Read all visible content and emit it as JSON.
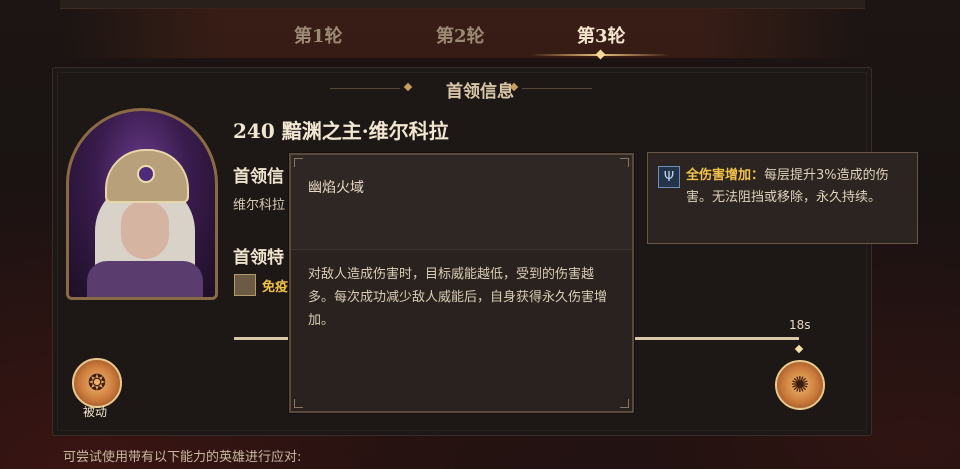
{
  "tabs": [
    {
      "label": "第1轮",
      "active": false
    },
    {
      "label": "第2轮",
      "active": false
    },
    {
      "label": "第3轮",
      "active": true
    }
  ],
  "panel": {
    "title": "首领信息",
    "boss_name": "240 黯渊之主·维尔科拉",
    "info_heading": "首领信",
    "info_text": "维尔科拉",
    "trait_heading": "首领特",
    "trait_label": "免疫",
    "timeline_label": "18s",
    "passive_label": "被动"
  },
  "skill_tooltip": {
    "title": "幽焰火域",
    "description": "对敌人造成伤害时，目标威能越低，受到的伤害越多。每次成功减少敌人威能后，自身获得永久伤害增加。"
  },
  "buff_tooltip": {
    "name": "全伤害增加",
    "separator": "：",
    "description": "每层提升3%造成的伤害。无法阻挡或移除，永久持续。",
    "icon": "trident-icon"
  },
  "footer": {
    "text": "可尝试使用带有以下能力的英雄进行应对:"
  },
  "colors": {
    "accent_gold": "#f0c24b",
    "bg": "#1a1412"
  }
}
